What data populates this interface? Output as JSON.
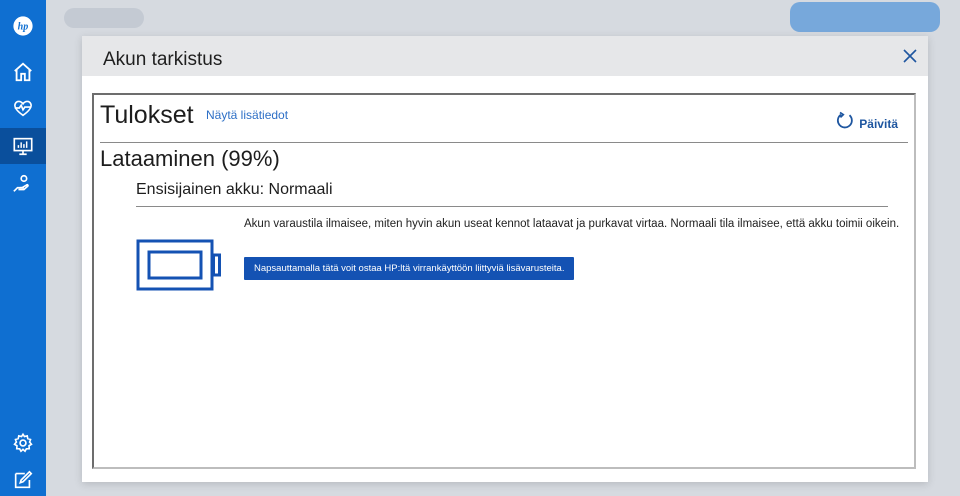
{
  "rail": {
    "items": [
      {
        "icon": "hp-logo-icon"
      },
      {
        "icon": "home-icon"
      },
      {
        "icon": "heart-pulse-icon"
      },
      {
        "icon": "monitor-chart-icon",
        "active": true
      },
      {
        "icon": "hand-support-icon"
      },
      {
        "icon": "gear-icon"
      },
      {
        "icon": "feedback-icon"
      }
    ]
  },
  "dialog": {
    "title": "Akun tarkistus",
    "close_icon": "close-icon"
  },
  "results": {
    "title": "Tulokset",
    "details_link": "Näytä lisätiedot",
    "refresh_label": "Päivitä",
    "status": "Lataaminen (99%)",
    "battery_level_percent": 99,
    "subtitle": "Ensisijainen akku: Normaali",
    "description": "Akun varaustila ilmaisee, miten hyvin akun useat kennot lataavat ja purkavat virtaa. Normaali tila ilmaisee, että akku toimii oikein.",
    "accessory_button": "Napsauttamalla tätä voit ostaa HP:ltä virrankäyttöön liittyviä lisävarusteita."
  },
  "colors": {
    "rail": "#0f6fd1",
    "rail_active": "#0a4f9c",
    "accent": "#1452b3",
    "link": "#2d6fc6"
  }
}
